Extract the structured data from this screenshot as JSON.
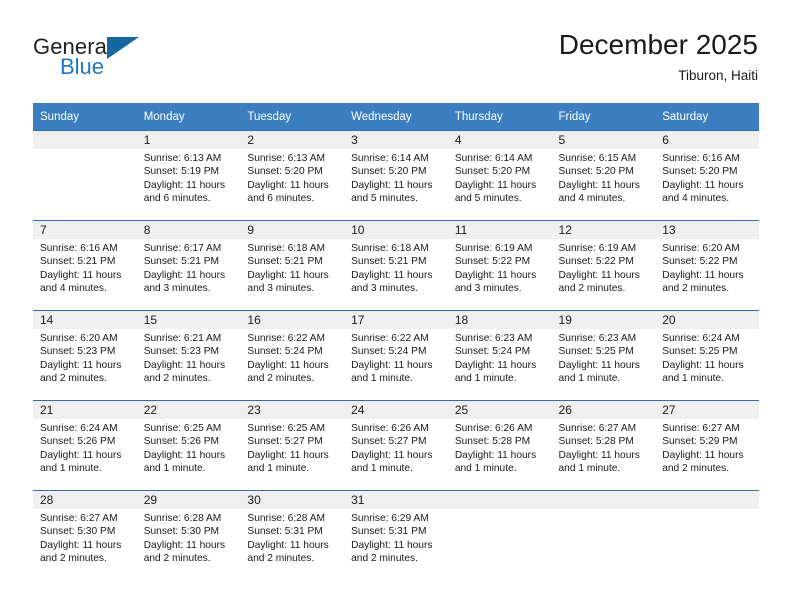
{
  "brand": {
    "name_top": "General",
    "name_bottom": "Blue"
  },
  "header": {
    "title": "December 2025",
    "subtitle": "Tiburon, Haiti"
  },
  "calendar": {
    "weekday_headers": [
      "Sunday",
      "Monday",
      "Tuesday",
      "Wednesday",
      "Thursday",
      "Friday",
      "Saturday"
    ],
    "accent_color": "#3a7ebf",
    "daynum_band_color": "#efefef",
    "weeks": [
      [
        {
          "day": ""
        },
        {
          "day": "1",
          "sunrise": "Sunrise: 6:13 AM",
          "sunset": "Sunset: 5:19 PM",
          "daylight_1": "Daylight: 11 hours",
          "daylight_2": "and 6 minutes."
        },
        {
          "day": "2",
          "sunrise": "Sunrise: 6:13 AM",
          "sunset": "Sunset: 5:20 PM",
          "daylight_1": "Daylight: 11 hours",
          "daylight_2": "and 6 minutes."
        },
        {
          "day": "3",
          "sunrise": "Sunrise: 6:14 AM",
          "sunset": "Sunset: 5:20 PM",
          "daylight_1": "Daylight: 11 hours",
          "daylight_2": "and 5 minutes."
        },
        {
          "day": "4",
          "sunrise": "Sunrise: 6:14 AM",
          "sunset": "Sunset: 5:20 PM",
          "daylight_1": "Daylight: 11 hours",
          "daylight_2": "and 5 minutes."
        },
        {
          "day": "5",
          "sunrise": "Sunrise: 6:15 AM",
          "sunset": "Sunset: 5:20 PM",
          "daylight_1": "Daylight: 11 hours",
          "daylight_2": "and 4 minutes."
        },
        {
          "day": "6",
          "sunrise": "Sunrise: 6:16 AM",
          "sunset": "Sunset: 5:20 PM",
          "daylight_1": "Daylight: 11 hours",
          "daylight_2": "and 4 minutes."
        }
      ],
      [
        {
          "day": "7",
          "sunrise": "Sunrise: 6:16 AM",
          "sunset": "Sunset: 5:21 PM",
          "daylight_1": "Daylight: 11 hours",
          "daylight_2": "and 4 minutes."
        },
        {
          "day": "8",
          "sunrise": "Sunrise: 6:17 AM",
          "sunset": "Sunset: 5:21 PM",
          "daylight_1": "Daylight: 11 hours",
          "daylight_2": "and 3 minutes."
        },
        {
          "day": "9",
          "sunrise": "Sunrise: 6:18 AM",
          "sunset": "Sunset: 5:21 PM",
          "daylight_1": "Daylight: 11 hours",
          "daylight_2": "and 3 minutes."
        },
        {
          "day": "10",
          "sunrise": "Sunrise: 6:18 AM",
          "sunset": "Sunset: 5:21 PM",
          "daylight_1": "Daylight: 11 hours",
          "daylight_2": "and 3 minutes."
        },
        {
          "day": "11",
          "sunrise": "Sunrise: 6:19 AM",
          "sunset": "Sunset: 5:22 PM",
          "daylight_1": "Daylight: 11 hours",
          "daylight_2": "and 3 minutes."
        },
        {
          "day": "12",
          "sunrise": "Sunrise: 6:19 AM",
          "sunset": "Sunset: 5:22 PM",
          "daylight_1": "Daylight: 11 hours",
          "daylight_2": "and 2 minutes."
        },
        {
          "day": "13",
          "sunrise": "Sunrise: 6:20 AM",
          "sunset": "Sunset: 5:22 PM",
          "daylight_1": "Daylight: 11 hours",
          "daylight_2": "and 2 minutes."
        }
      ],
      [
        {
          "day": "14",
          "sunrise": "Sunrise: 6:20 AM",
          "sunset": "Sunset: 5:23 PM",
          "daylight_1": "Daylight: 11 hours",
          "daylight_2": "and 2 minutes."
        },
        {
          "day": "15",
          "sunrise": "Sunrise: 6:21 AM",
          "sunset": "Sunset: 5:23 PM",
          "daylight_1": "Daylight: 11 hours",
          "daylight_2": "and 2 minutes."
        },
        {
          "day": "16",
          "sunrise": "Sunrise: 6:22 AM",
          "sunset": "Sunset: 5:24 PM",
          "daylight_1": "Daylight: 11 hours",
          "daylight_2": "and 2 minutes."
        },
        {
          "day": "17",
          "sunrise": "Sunrise: 6:22 AM",
          "sunset": "Sunset: 5:24 PM",
          "daylight_1": "Daylight: 11 hours",
          "daylight_2": "and 1 minute."
        },
        {
          "day": "18",
          "sunrise": "Sunrise: 6:23 AM",
          "sunset": "Sunset: 5:24 PM",
          "daylight_1": "Daylight: 11 hours",
          "daylight_2": "and 1 minute."
        },
        {
          "day": "19",
          "sunrise": "Sunrise: 6:23 AM",
          "sunset": "Sunset: 5:25 PM",
          "daylight_1": "Daylight: 11 hours",
          "daylight_2": "and 1 minute."
        },
        {
          "day": "20",
          "sunrise": "Sunrise: 6:24 AM",
          "sunset": "Sunset: 5:25 PM",
          "daylight_1": "Daylight: 11 hours",
          "daylight_2": "and 1 minute."
        }
      ],
      [
        {
          "day": "21",
          "sunrise": "Sunrise: 6:24 AM",
          "sunset": "Sunset: 5:26 PM",
          "daylight_1": "Daylight: 11 hours",
          "daylight_2": "and 1 minute."
        },
        {
          "day": "22",
          "sunrise": "Sunrise: 6:25 AM",
          "sunset": "Sunset: 5:26 PM",
          "daylight_1": "Daylight: 11 hours",
          "daylight_2": "and 1 minute."
        },
        {
          "day": "23",
          "sunrise": "Sunrise: 6:25 AM",
          "sunset": "Sunset: 5:27 PM",
          "daylight_1": "Daylight: 11 hours",
          "daylight_2": "and 1 minute."
        },
        {
          "day": "24",
          "sunrise": "Sunrise: 6:26 AM",
          "sunset": "Sunset: 5:27 PM",
          "daylight_1": "Daylight: 11 hours",
          "daylight_2": "and 1 minute."
        },
        {
          "day": "25",
          "sunrise": "Sunrise: 6:26 AM",
          "sunset": "Sunset: 5:28 PM",
          "daylight_1": "Daylight: 11 hours",
          "daylight_2": "and 1 minute."
        },
        {
          "day": "26",
          "sunrise": "Sunrise: 6:27 AM",
          "sunset": "Sunset: 5:28 PM",
          "daylight_1": "Daylight: 11 hours",
          "daylight_2": "and 1 minute."
        },
        {
          "day": "27",
          "sunrise": "Sunrise: 6:27 AM",
          "sunset": "Sunset: 5:29 PM",
          "daylight_1": "Daylight: 11 hours",
          "daylight_2": "and 2 minutes."
        }
      ],
      [
        {
          "day": "28",
          "sunrise": "Sunrise: 6:27 AM",
          "sunset": "Sunset: 5:30 PM",
          "daylight_1": "Daylight: 11 hours",
          "daylight_2": "and 2 minutes."
        },
        {
          "day": "29",
          "sunrise": "Sunrise: 6:28 AM",
          "sunset": "Sunset: 5:30 PM",
          "daylight_1": "Daylight: 11 hours",
          "daylight_2": "and 2 minutes."
        },
        {
          "day": "30",
          "sunrise": "Sunrise: 6:28 AM",
          "sunset": "Sunset: 5:31 PM",
          "daylight_1": "Daylight: 11 hours",
          "daylight_2": "and 2 minutes."
        },
        {
          "day": "31",
          "sunrise": "Sunrise: 6:29 AM",
          "sunset": "Sunset: 5:31 PM",
          "daylight_1": "Daylight: 11 hours",
          "daylight_2": "and 2 minutes."
        },
        {
          "day": ""
        },
        {
          "day": ""
        },
        {
          "day": ""
        }
      ]
    ]
  }
}
